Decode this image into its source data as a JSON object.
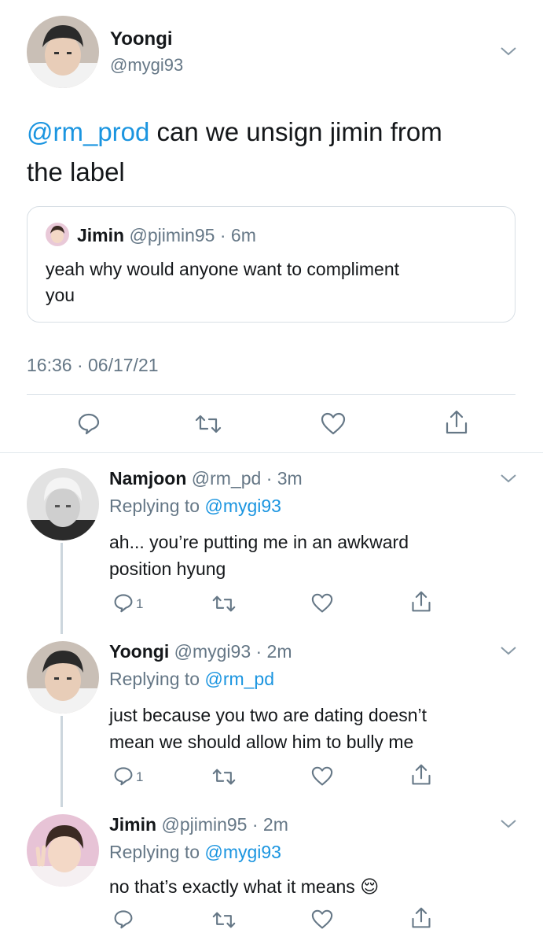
{
  "main_tweet": {
    "author_name": "Yoongi",
    "author_handle": "@mygi93",
    "mention": "@rm_prod",
    "text_line1": " can we unsign jimin from",
    "text_line2": "the label",
    "timestamp": "16:36 · 06/17/21",
    "quoted": {
      "author_name": "Jimin",
      "meta": "@pjimin95 · 6m",
      "text_line1": "yeah why would anyone want to compliment",
      "text_line2": "you"
    }
  },
  "replies": [
    {
      "author_name": "Namjoon",
      "meta": "@rm_pd · 3m",
      "replying_prefix": "Replying to ",
      "replying_to": "@mygi93",
      "text_line1": "ah... you’re putting me in an awkward",
      "text_line2": "position hyung",
      "reply_count": "1"
    },
    {
      "author_name": "Yoongi",
      "meta": "@mygi93 · 2m",
      "replying_prefix": "Replying to ",
      "replying_to": "@rm_pd",
      "text_line1": "just because you two are dating doesn’t",
      "text_line2": "mean we should allow him to bully me",
      "reply_count": "1"
    },
    {
      "author_name": "Jimin",
      "meta": "@pjimin95 · 2m",
      "replying_prefix": "Replying to ",
      "replying_to": "@mygi93",
      "text_line1": "no that’s exactly what it means",
      "emoji": "😌",
      "reply_count": ""
    }
  ],
  "colors": {
    "link": "#1b95e0",
    "muted": "#657786",
    "text": "#14171a",
    "divider": "#e1e8ed"
  },
  "icons": [
    "chevron-down-icon",
    "reply-icon",
    "retweet-icon",
    "like-icon",
    "share-icon"
  ]
}
